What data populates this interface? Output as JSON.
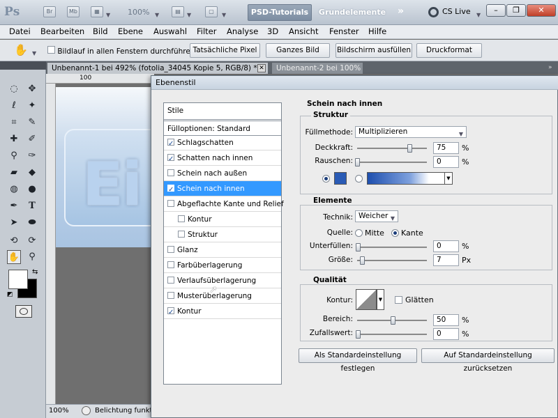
{
  "app": {
    "logo": "Ps",
    "bridge_icon": "Br",
    "minibridge_icon": "Mb",
    "zoom": "100%",
    "workspace_active": "PSD-Tutorials",
    "workspace_other": "Grundelemente",
    "cs_live": "CS Live"
  },
  "menu": [
    "Datei",
    "Bearbeiten",
    "Bild",
    "Ebene",
    "Auswahl",
    "Filter",
    "Analyse",
    "3D",
    "Ansicht",
    "Fenster",
    "Hilfe"
  ],
  "options": {
    "scroll_all_label": "Bildlauf in allen Fenstern durchführen",
    "btn_actual": "Tatsächliche Pixel",
    "btn_fit": "Ganzes Bild",
    "btn_fill": "Bildschirm ausfüllen",
    "btn_print": "Druckformat"
  },
  "documents": {
    "tab1": "Unbenannt-1 bei 492% (fotolia_34045 Kopie 5, RGB/8) *",
    "tab2": "Unbenannt-2 bei 100%",
    "ruler_mark": "100",
    "canvas_text": "Ei",
    "zoom_status": "100%",
    "status_text": "Belichtung funktioniert nur bei 32-Bit"
  },
  "dialog": {
    "title": "Ebenenstil",
    "styles_header": "Stile",
    "blending": "Fülloptionen: Standard",
    "styles": [
      {
        "label": "Schlagschatten",
        "checked": true
      },
      {
        "label": "Schatten nach innen",
        "checked": true
      },
      {
        "label": "Schein nach außen",
        "checked": false
      },
      {
        "label": "Schein nach innen",
        "checked": true,
        "selected": true
      },
      {
        "label": "Abgeflachte Kante und Relief",
        "checked": false
      },
      {
        "label": "Kontur",
        "checked": false,
        "sub": true
      },
      {
        "label": "Struktur",
        "checked": false,
        "sub": true
      },
      {
        "label": "Glanz",
        "checked": false
      },
      {
        "label": "Farbüberlagerung",
        "checked": false
      },
      {
        "label": "Verlaufsüberlagerung",
        "checked": false
      },
      {
        "label": "Musterüberlagerung",
        "checked": false
      },
      {
        "label": "Kontur",
        "checked": true
      }
    ],
    "section_title": "Schein nach innen",
    "struktur": {
      "title": "Struktur",
      "blend_label": "Füllmethode:",
      "blend_value": "Multiplizieren",
      "opacity_label": "Deckkraft:",
      "opacity_value": "75",
      "noise_label": "Rauschen:",
      "noise_value": "0",
      "percent": "%",
      "opacity_fraction": 0.75,
      "noise_fraction": 0,
      "color": "#2a5bb5",
      "color_mode": "solid"
    },
    "elemente": {
      "title": "Elemente",
      "technique_label": "Technik:",
      "technique_value": "Weicher",
      "source_label": "Quelle:",
      "source_center": "Mitte",
      "source_edge": "Kante",
      "source_selected": "Kante",
      "choke_label": "Unterfüllen:",
      "choke_value": "0",
      "size_label": "Größe:",
      "size_value": "7",
      "unit_px": "Px",
      "percent": "%"
    },
    "qualitaet": {
      "title": "Qualität",
      "contour_label": "Kontur:",
      "antialias_label": "Glätten",
      "range_label": "Bereich:",
      "range_value": "50",
      "jitter_label": "Zufallswert:",
      "jitter_value": "0",
      "percent": "%"
    },
    "btn_default_set": "Als Standardeinstellung festlegen",
    "btn_default_reset": "Auf Standardeinstellung zurücksetzen"
  }
}
